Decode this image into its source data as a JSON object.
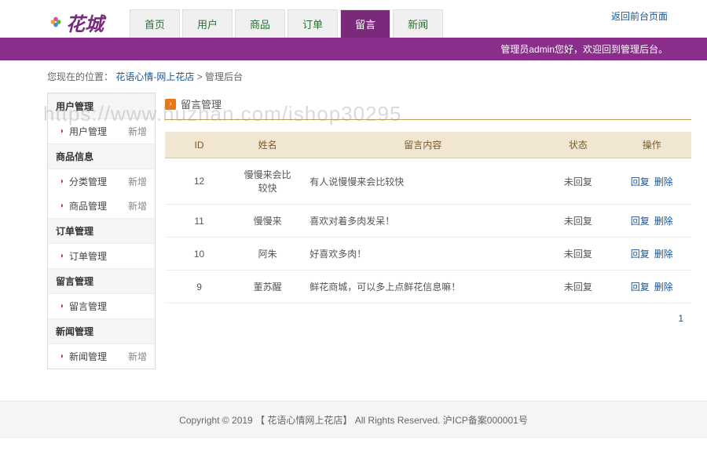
{
  "top_link": "返回前台页面",
  "logo_text": "花城",
  "nav": [
    {
      "label": "首页",
      "active": false
    },
    {
      "label": "用户",
      "active": false
    },
    {
      "label": "商品",
      "active": false
    },
    {
      "label": "订单",
      "active": false
    },
    {
      "label": "留言",
      "active": true
    },
    {
      "label": "新闻",
      "active": false
    }
  ],
  "admin_bar": "管理员admin您好，欢迎回到管理后台。",
  "breadcrumb": {
    "prefix": "您现在的位置：",
    "link": "花语心情-网上花店",
    "sep": " > ",
    "current": "管理后台"
  },
  "sidebar": [
    {
      "header": "用户管理",
      "items": [
        {
          "label": "用户管理",
          "add": "新增"
        }
      ]
    },
    {
      "header": "商品信息",
      "items": [
        {
          "label": "分类管理",
          "add": "新增"
        },
        {
          "label": "商品管理",
          "add": "新增"
        }
      ]
    },
    {
      "header": "订单管理",
      "items": [
        {
          "label": "订单管理",
          "add": ""
        }
      ]
    },
    {
      "header": "留言管理",
      "items": [
        {
          "label": "留言管理",
          "add": ""
        }
      ]
    },
    {
      "header": "新闻管理",
      "items": [
        {
          "label": "新闻管理",
          "add": "新增"
        }
      ]
    }
  ],
  "content": {
    "title": "留言管理",
    "table": {
      "headers": [
        "ID",
        "姓名",
        "留言内容",
        "状态",
        "操作"
      ],
      "rows": [
        {
          "id": "12",
          "name": "慢慢来会比较快",
          "content": "有人说慢慢来会比较快",
          "status": "未回复",
          "actions": [
            "回复",
            "删除"
          ]
        },
        {
          "id": "11",
          "name": "慢慢来",
          "content": "喜欢对着多肉发呆！",
          "status": "未回复",
          "actions": [
            "回复",
            "删除"
          ]
        },
        {
          "id": "10",
          "name": "阿朱",
          "content": "好喜欢多肉！",
          "status": "未回复",
          "actions": [
            "回复",
            "删除"
          ]
        },
        {
          "id": "9",
          "name": "董苏醒",
          "content": "鲜花商城，可以多上点鲜花信息嘛！",
          "status": "未回复",
          "actions": [
            "回复",
            "删除"
          ]
        }
      ]
    },
    "pagination": {
      "current": "1"
    }
  },
  "footer": "Copyright © 2019 【 花语心情网上花店】 All Rights Reserved. 沪ICP备案000001号",
  "watermark": "https://www.huzhan.com/ishop30295"
}
